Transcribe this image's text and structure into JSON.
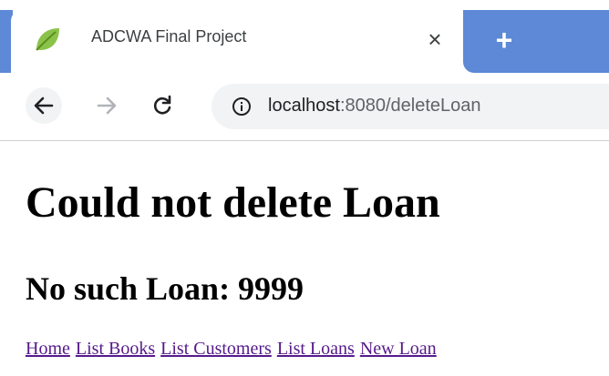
{
  "browser": {
    "tab": {
      "title": "ADCWA Final Project",
      "close": "×"
    },
    "new_tab": "+",
    "url": {
      "host": "localhost",
      "rest": ":8080/deleteLoan"
    },
    "accent_color": "#5d89d6"
  },
  "page": {
    "heading": "Could not delete Loan",
    "subheading": "No such Loan: 9999",
    "links": [
      "Home",
      "List Books",
      "List Customers",
      "List Loans",
      "New Loan"
    ]
  }
}
